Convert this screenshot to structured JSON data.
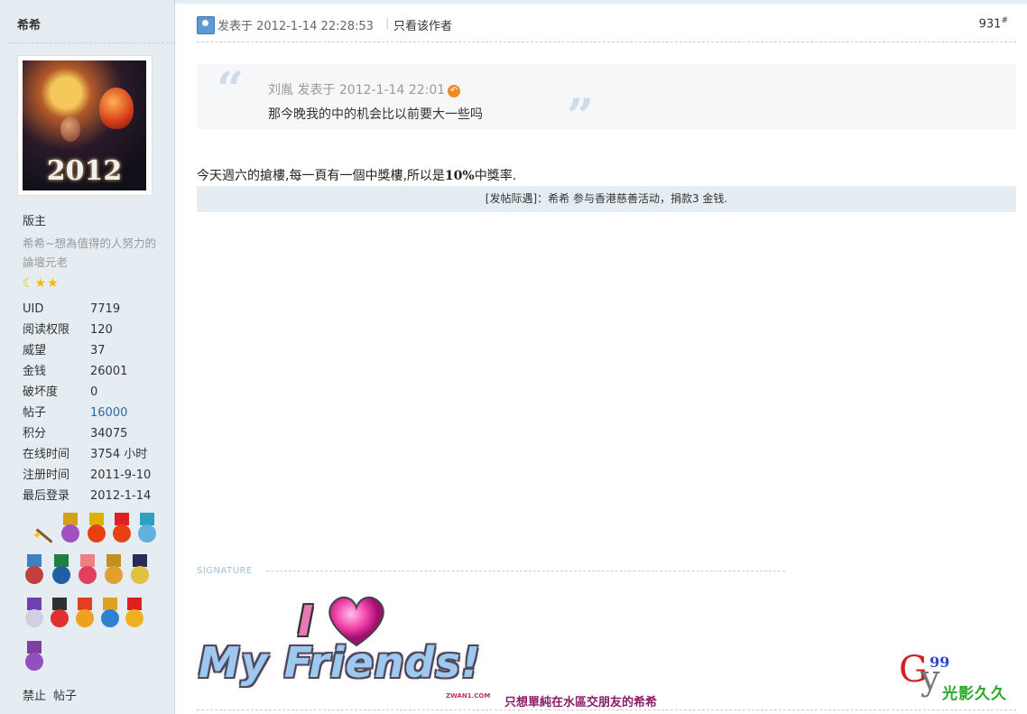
{
  "author": "希希",
  "user": {
    "rank": "版主",
    "custom_title": "希希~想為值得的人努力的論壇元老",
    "star_icons": "moon-star-star",
    "stats": [
      {
        "label": "UID",
        "value": "7719"
      },
      {
        "label": "阅读权限",
        "value": "120"
      },
      {
        "label": "威望",
        "value": "37"
      },
      {
        "label": "金钱",
        "value": "26001"
      },
      {
        "label": "破坏度",
        "value": "0"
      },
      {
        "label": "帖子",
        "value": "16000"
      },
      {
        "label": "积分",
        "value": "34075"
      },
      {
        "label": "在线时间",
        "value": "3754 小时"
      },
      {
        "label": "注册时间",
        "value": "2011-9-10"
      },
      {
        "label": "最后登录",
        "value": "2012-1-14"
      }
    ],
    "links": {
      "ban": "禁止",
      "posts": "帖子"
    }
  },
  "avatar": {
    "year_text": "2012"
  },
  "post": {
    "posted_at": "发表于 2012-1-14 22:28:53",
    "only_author": "只看该作者",
    "floor": "931",
    "floor_mark": "#",
    "quote": {
      "meta": "刘胤 发表于 2012-1-14 22:01",
      "text": "那今晚我的中的机会比以前要大一些吗"
    },
    "message_before": "今天週六的搶樓,每一頁有一個中獎樓,所以是",
    "message_bold": "10%",
    "message_after": "中獎率.",
    "reward": "[发帖际遇]：希希 参与香港慈善活动，捐款3 金钱."
  },
  "signature": {
    "label": "SIGNATURE",
    "image_top": "I",
    "image_bottom": "My Friends!",
    "image_brand": "ZWAN1.COM",
    "text": "只想單純在水區交朋友的希希",
    "logo_g": "G",
    "logo_y": "y",
    "logo_99": "99",
    "logo_text": "光影久久"
  },
  "colors": {
    "sidebar_bg": "#e5edf2",
    "link": "#336699",
    "reward_bg": "#e5edf2"
  }
}
